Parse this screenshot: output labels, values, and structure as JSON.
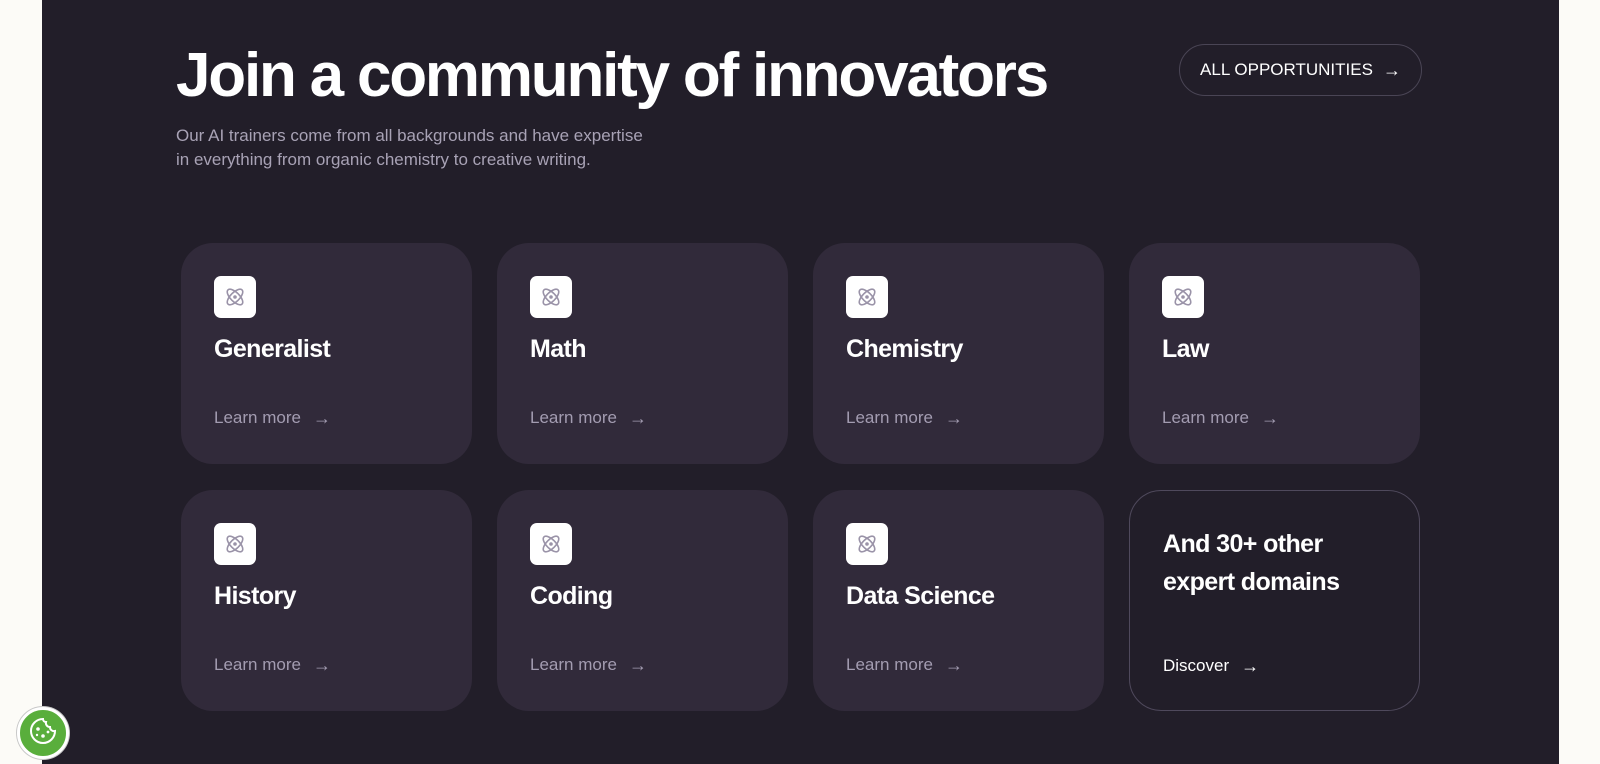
{
  "header": {
    "title": "Join a community of innovators",
    "subtitle_line1": "Our AI trainers come from all backgrounds and have expertise",
    "subtitle_line2": "in everything from organic chemistry to creative writing.",
    "all_opportunities_label": "ALL OPPORTUNITIES",
    "arrow": "→"
  },
  "cards": [
    {
      "title": "Generalist",
      "link": "Learn more",
      "icon": "atom-icon"
    },
    {
      "title": "Math",
      "link": "Learn more",
      "icon": "atom-icon"
    },
    {
      "title": "Chemistry",
      "link": "Learn more",
      "icon": "atom-icon"
    },
    {
      "title": "Law",
      "link": "Learn more",
      "icon": "atom-icon"
    },
    {
      "title": "History",
      "link": "Learn more",
      "icon": "atom-icon"
    },
    {
      "title": "Coding",
      "link": "Learn more",
      "icon": "atom-icon"
    },
    {
      "title": "Data Science",
      "link": "Learn more",
      "icon": "atom-icon"
    }
  ],
  "other_card": {
    "title_line1": "And 30+ other",
    "title_line2": "expert domains",
    "link": "Discover"
  },
  "cookie_button": {
    "icon": "cookie-icon"
  },
  "colors": {
    "page_background": "#fcfbf7",
    "panel_background": "#221e29",
    "card_background": "#312a3a",
    "muted_text": "#a39cb1",
    "cookie_green": "#59ae3c"
  }
}
